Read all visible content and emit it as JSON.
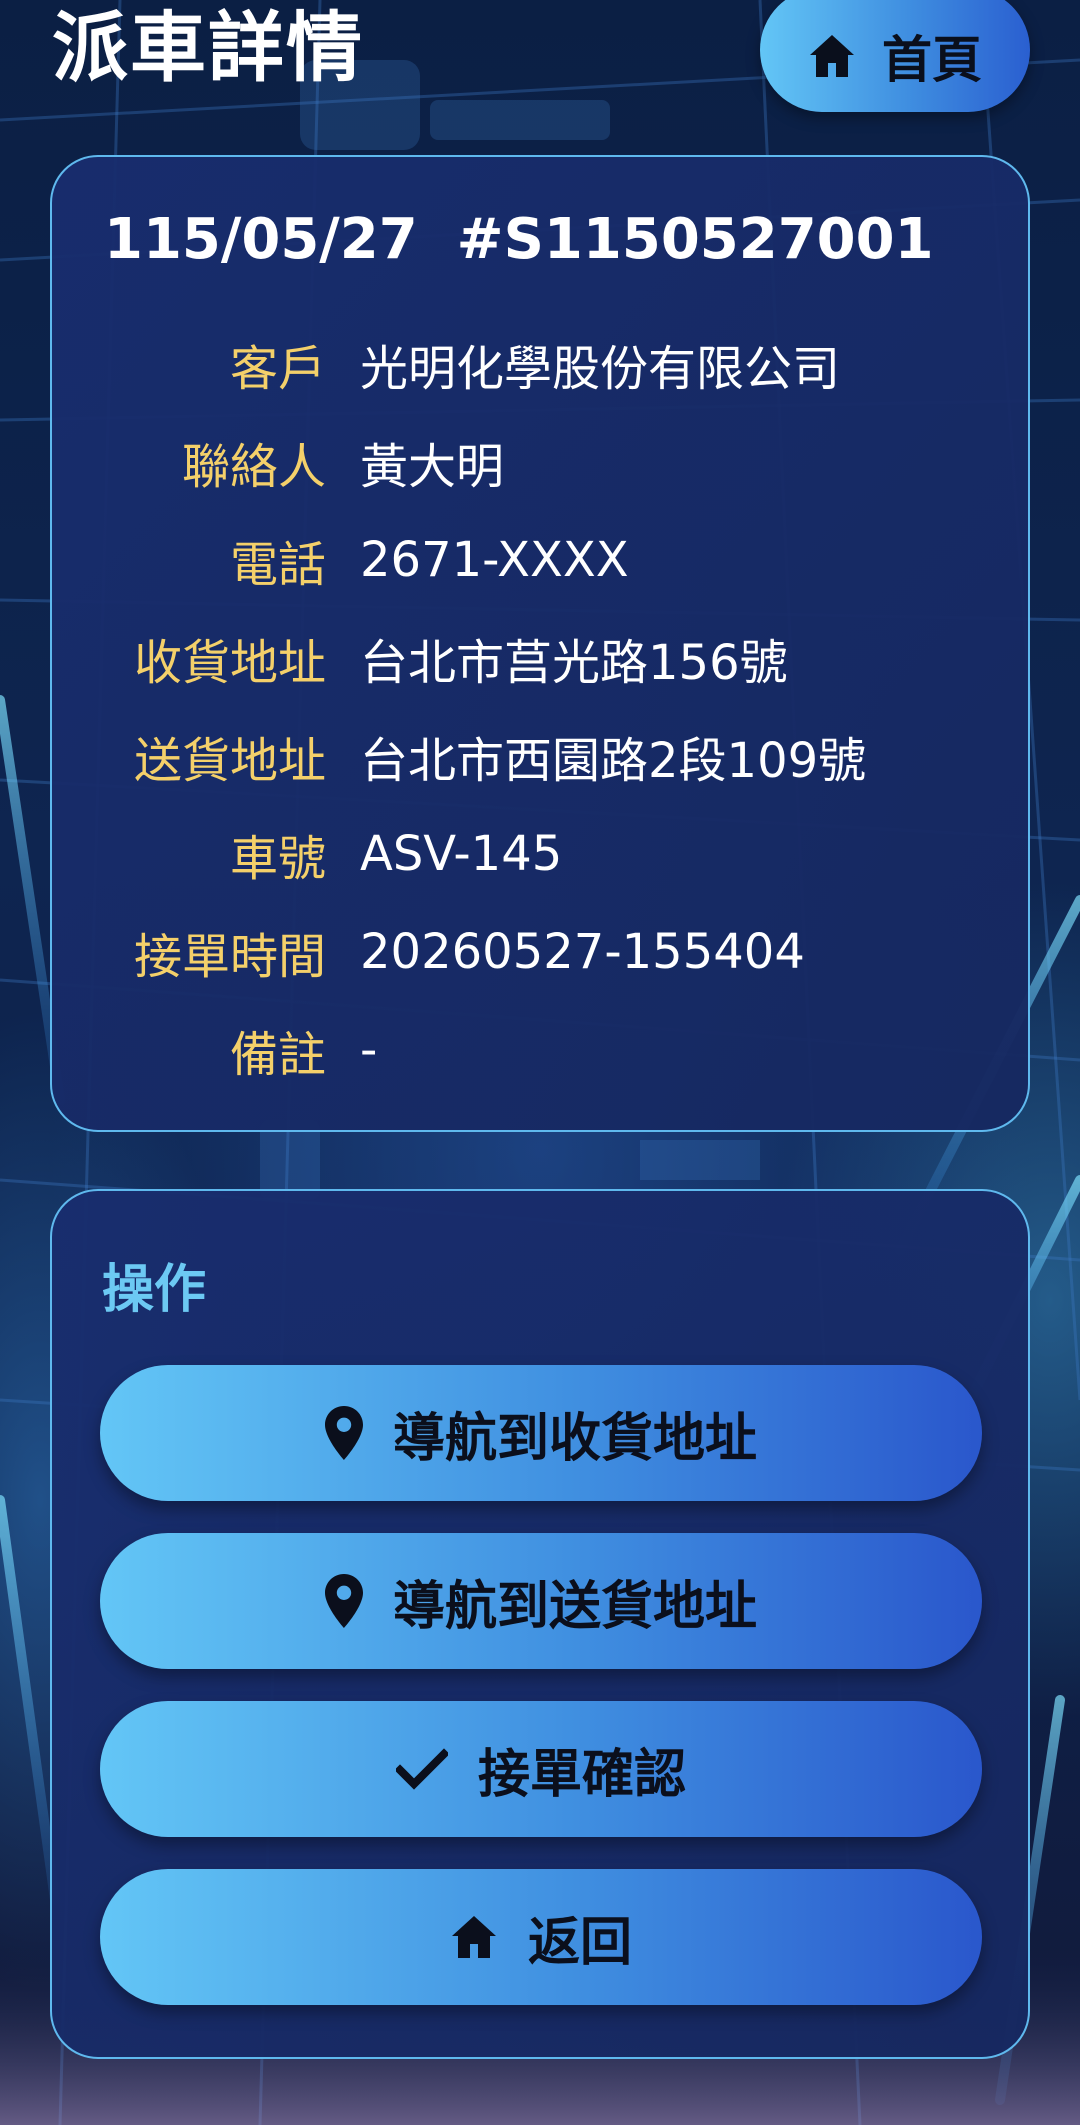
{
  "header": {
    "title": "派車詳情",
    "home_label": "首頁"
  },
  "detail": {
    "date": "115/05/27",
    "order_no": "#S1150527001",
    "rows": [
      {
        "label": "客戶",
        "value": "光明化學股份有限公司"
      },
      {
        "label": "聯絡人",
        "value": "黃大明"
      },
      {
        "label": "電話",
        "value": "2671-XXXX"
      },
      {
        "label": "收貨地址",
        "value": "台北市莒光路156號"
      },
      {
        "label": "送貨地址",
        "value": "台北市西園路2段109號"
      },
      {
        "label": "車號",
        "value": "ASV-145"
      },
      {
        "label": "接單時間",
        "value": "20260527-155404"
      },
      {
        "label": "備註",
        "value": "-"
      }
    ]
  },
  "operations": {
    "title": "操作",
    "buttons": [
      {
        "label": "導航到收貨地址",
        "icon": "map-pin-icon"
      },
      {
        "label": "導航到送貨地址",
        "icon": "map-pin-icon"
      },
      {
        "label": "接單確認",
        "icon": "check-icon"
      },
      {
        "label": "返回",
        "icon": "home-icon"
      }
    ]
  },
  "colors": {
    "label": "#f4d06a",
    "ops_title": "#6cc9f3",
    "card_border": "#5fb9ee",
    "button_start": "#63c6f6",
    "button_end": "#2a57cc"
  }
}
